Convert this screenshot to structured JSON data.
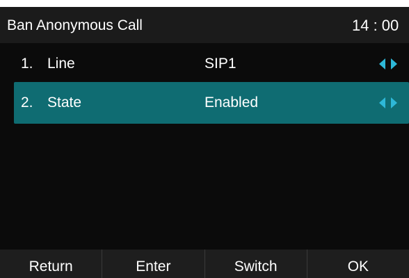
{
  "header": {
    "title": "Ban Anonymous Call",
    "time": "14 : 00"
  },
  "menu": {
    "items": [
      {
        "number": "1.",
        "label": "Line",
        "value": "SIP1",
        "selected": false
      },
      {
        "number": "2.",
        "label": "State",
        "value": "Enabled",
        "selected": true
      }
    ]
  },
  "softkeys": {
    "return_label": "Return",
    "enter_label": "Enter",
    "switch_label": "Switch",
    "ok_label": "OK"
  },
  "colors": {
    "selection": "#0f6c72",
    "arrow": "#2eb8d8",
    "background": "#0b0b0b"
  },
  "icons": [
    "left-arrow-icon",
    "right-arrow-icon"
  ]
}
